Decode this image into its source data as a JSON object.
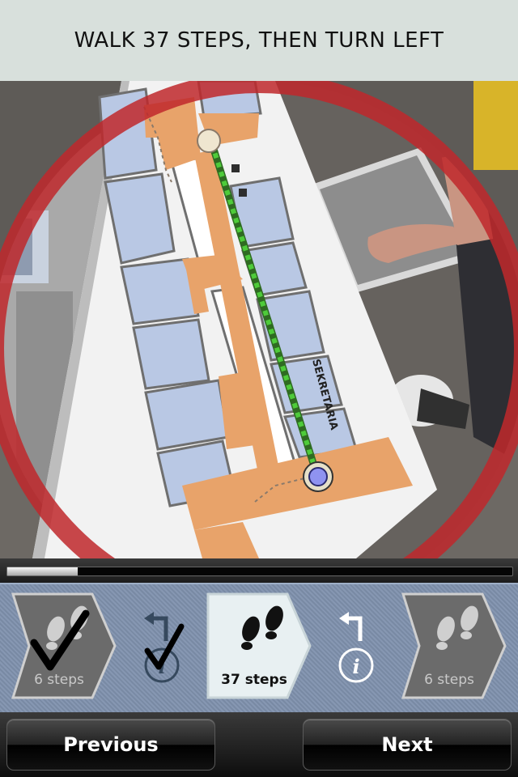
{
  "instruction": {
    "text": "WALK 37 STEPS, THEN TURN LEFT"
  },
  "progress": {
    "fraction": 0.14
  },
  "steps": [
    {
      "label": "6 steps",
      "state": "done",
      "icon": "footsteps-icon"
    },
    {
      "label": "37 steps",
      "state": "current",
      "icon": "footsteps-icon"
    },
    {
      "label": "6 steps",
      "state": "upcoming",
      "icon": "footsteps-icon"
    }
  ],
  "turns": [
    {
      "direction": "left",
      "state": "done",
      "icon": "turn-left-icon"
    },
    {
      "direction": "left",
      "state": "upcoming",
      "icon": "turn-left-icon"
    }
  ],
  "map": {
    "sign_text": "SEKRETARIA"
  },
  "nav": {
    "previous_label": "Previous",
    "next_label": "Next"
  },
  "colors": {
    "ring": "#c0282b",
    "route": "#4ecb3a",
    "corridor": "#e8a36a",
    "room": "#b9c8e4",
    "strip": "#7f91ad"
  }
}
